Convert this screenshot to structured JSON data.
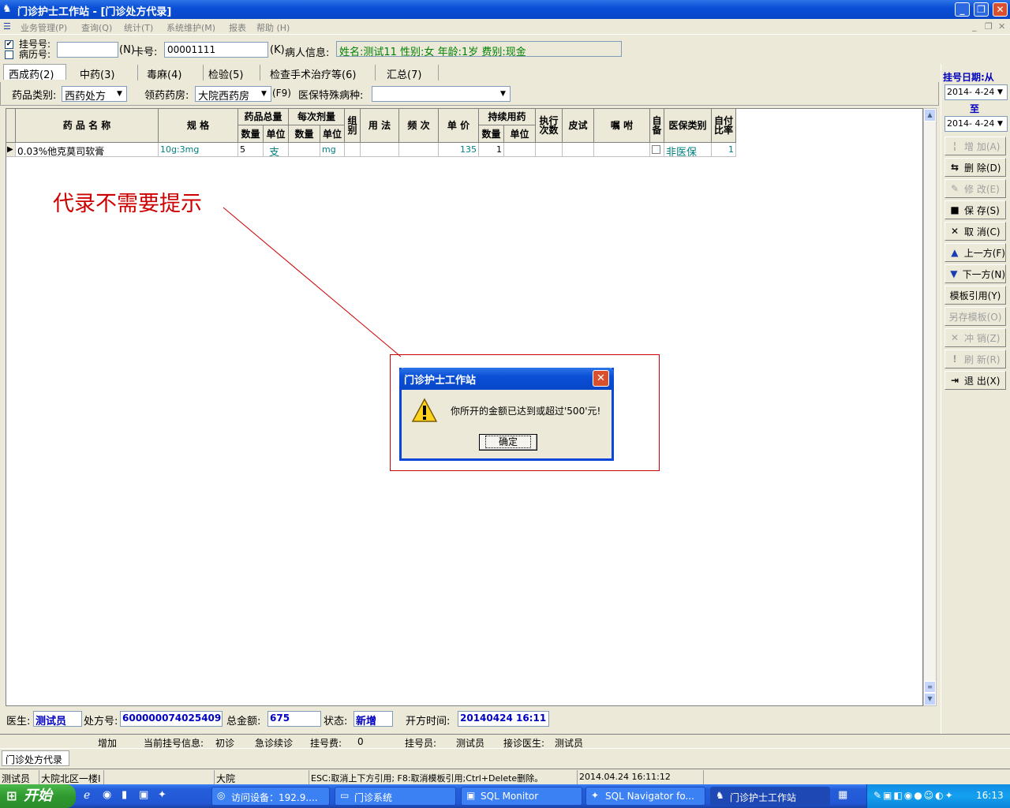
{
  "window": {
    "title": "门诊护士工作站 - [门诊处方代录]",
    "min": "_",
    "restore": "❐",
    "close": "✕"
  },
  "menu": [
    "业务管理(P)",
    "查询(Q)",
    "统计(T)",
    "系统维护(M)",
    "报表",
    "帮助 (H)"
  ],
  "mdi_controls": [
    "_",
    "❐",
    "✕"
  ],
  "topbar": {
    "reg_no_label": "挂号号:",
    "record_no_label": "病历号:",
    "reg_checked": true,
    "record_checked": false,
    "reg_value": "",
    "n_key": "(N)",
    "card_label": "卡号:",
    "card_value": "00001111",
    "k_key": "(K)",
    "patient_label": "病人信息:",
    "patient_info": "姓名:测试11 性别:女 年龄:1岁 费别:现金"
  },
  "tabs": [
    "西成药(2)",
    "中药(3)",
    "毒麻(4)",
    "检验(5)",
    "检查手术治疗等(6)",
    "汇总(7)"
  ],
  "filters": {
    "drug_type_label": "药品类别:",
    "drug_type_value": "西药处方",
    "pharmacy_label": "领药药房:",
    "pharmacy_value": "大院西药房",
    "f9": "(F9)",
    "special_label": "医保特殊病种:",
    "special_value": ""
  },
  "grid": {
    "headers": {
      "name": "药 品 名 称",
      "spec": "规  格",
      "total": "药品总量",
      "total_qty": "数量",
      "total_unit": "单位",
      "dose": "每次剂量",
      "dose_qty": "数量",
      "dose_unit": "单位",
      "group": "组别",
      "usage": "用 法",
      "freq": "频 次",
      "price": "单 价",
      "cont": "持续用药",
      "cont_qty": "数量",
      "cont_unit": "单位",
      "exec": "执行次数",
      "skin": "皮试",
      "advice": "嘱 咐",
      "self": "自备",
      "ins_type": "医保类别",
      "self_ratio": "自付比率"
    },
    "row": {
      "marker": "▶",
      "name": "0.03%他克莫司软膏",
      "spec": "10g:3mg",
      "total_qty": "5",
      "total_unit": "支",
      "dose_qty": "",
      "dose_unit": "mg",
      "group": "",
      "usage": "",
      "freq": "",
      "price": "135",
      "cont_qty": "1",
      "cont_unit": "",
      "exec": "",
      "skin": "",
      "advice": "",
      "self_checked": false,
      "ins_type": "非医保",
      "self_ratio": "1"
    }
  },
  "annotation": {
    "text": "代录不需要提示",
    "color": "#cc0000"
  },
  "dialog": {
    "title": "门诊护士工作站",
    "message": "你所开的金额已达到或超过'500'元!",
    "ok": "确定"
  },
  "right_panel": {
    "date_label": "挂号日期:从",
    "date_from": "2014- 4-24",
    "to_label": "至",
    "date_to": "2014- 4-24",
    "buttons": [
      {
        "icon": "¦",
        "label": "增 加(A)",
        "enabled": false
      },
      {
        "icon": "⇆",
        "label": "删 除(D)",
        "enabled": true
      },
      {
        "icon": "✎",
        "label": "修 改(E)",
        "enabled": false
      },
      {
        "icon": "■",
        "label": "保 存(S)",
        "enabled": true
      },
      {
        "icon": "✕",
        "label": "取 消(C)",
        "enabled": true
      },
      {
        "icon": "▲",
        "label": "上一方(F)",
        "enabled": true
      },
      {
        "icon": "▼",
        "label": "下一方(N)",
        "enabled": true
      },
      {
        "icon": "",
        "label": "模板引用(Y)",
        "enabled": true
      },
      {
        "icon": "",
        "label": "另存模板(O)",
        "enabled": false
      },
      {
        "icon": "✕",
        "label": "冲 销(Z)",
        "enabled": false
      },
      {
        "icon": "!",
        "label": "刷 新(R)",
        "enabled": false
      },
      {
        "icon": "⇥",
        "label": "退 出(X)",
        "enabled": true
      }
    ]
  },
  "footer": {
    "doctor_label": "医生:",
    "doctor": "测试员",
    "rx_label": "处方号:",
    "rx_no": "600000074025409",
    "total_label": "总金额:",
    "total": "675",
    "status_label": "状态:",
    "status": "新增",
    "time_label": "开方时间:",
    "time": "20140424 16:11"
  },
  "infobar": [
    "增加",
    "当前挂号信息:",
    "初诊",
    "急诊续诊",
    "挂号费:",
    "0",
    "挂号员:",
    "测试员",
    "接诊医生:",
    "测试员"
  ],
  "doc_tab": "门诊处方代录",
  "statusbar": [
    "测试员",
    "大院北区一楼I",
    "",
    "大院",
    "ESC:取消上下方引用; F8:取消模板引用;Ctrl+Delete删除。",
    "2014.04.24 16:11:12"
  ],
  "taskbar": {
    "start": "开始",
    "tasks": [
      "访问设备：192.9....",
      "门诊系统",
      "SQL Monitor",
      "SQL Navigator fo...",
      "门诊护士工作站"
    ],
    "clock": "16:13"
  },
  "colors": {
    "accent": "#0a4fd6",
    "patient_info": "#008000",
    "bound_value": "#0000c0",
    "annotation": "#cc0000",
    "spec": "#008080"
  }
}
